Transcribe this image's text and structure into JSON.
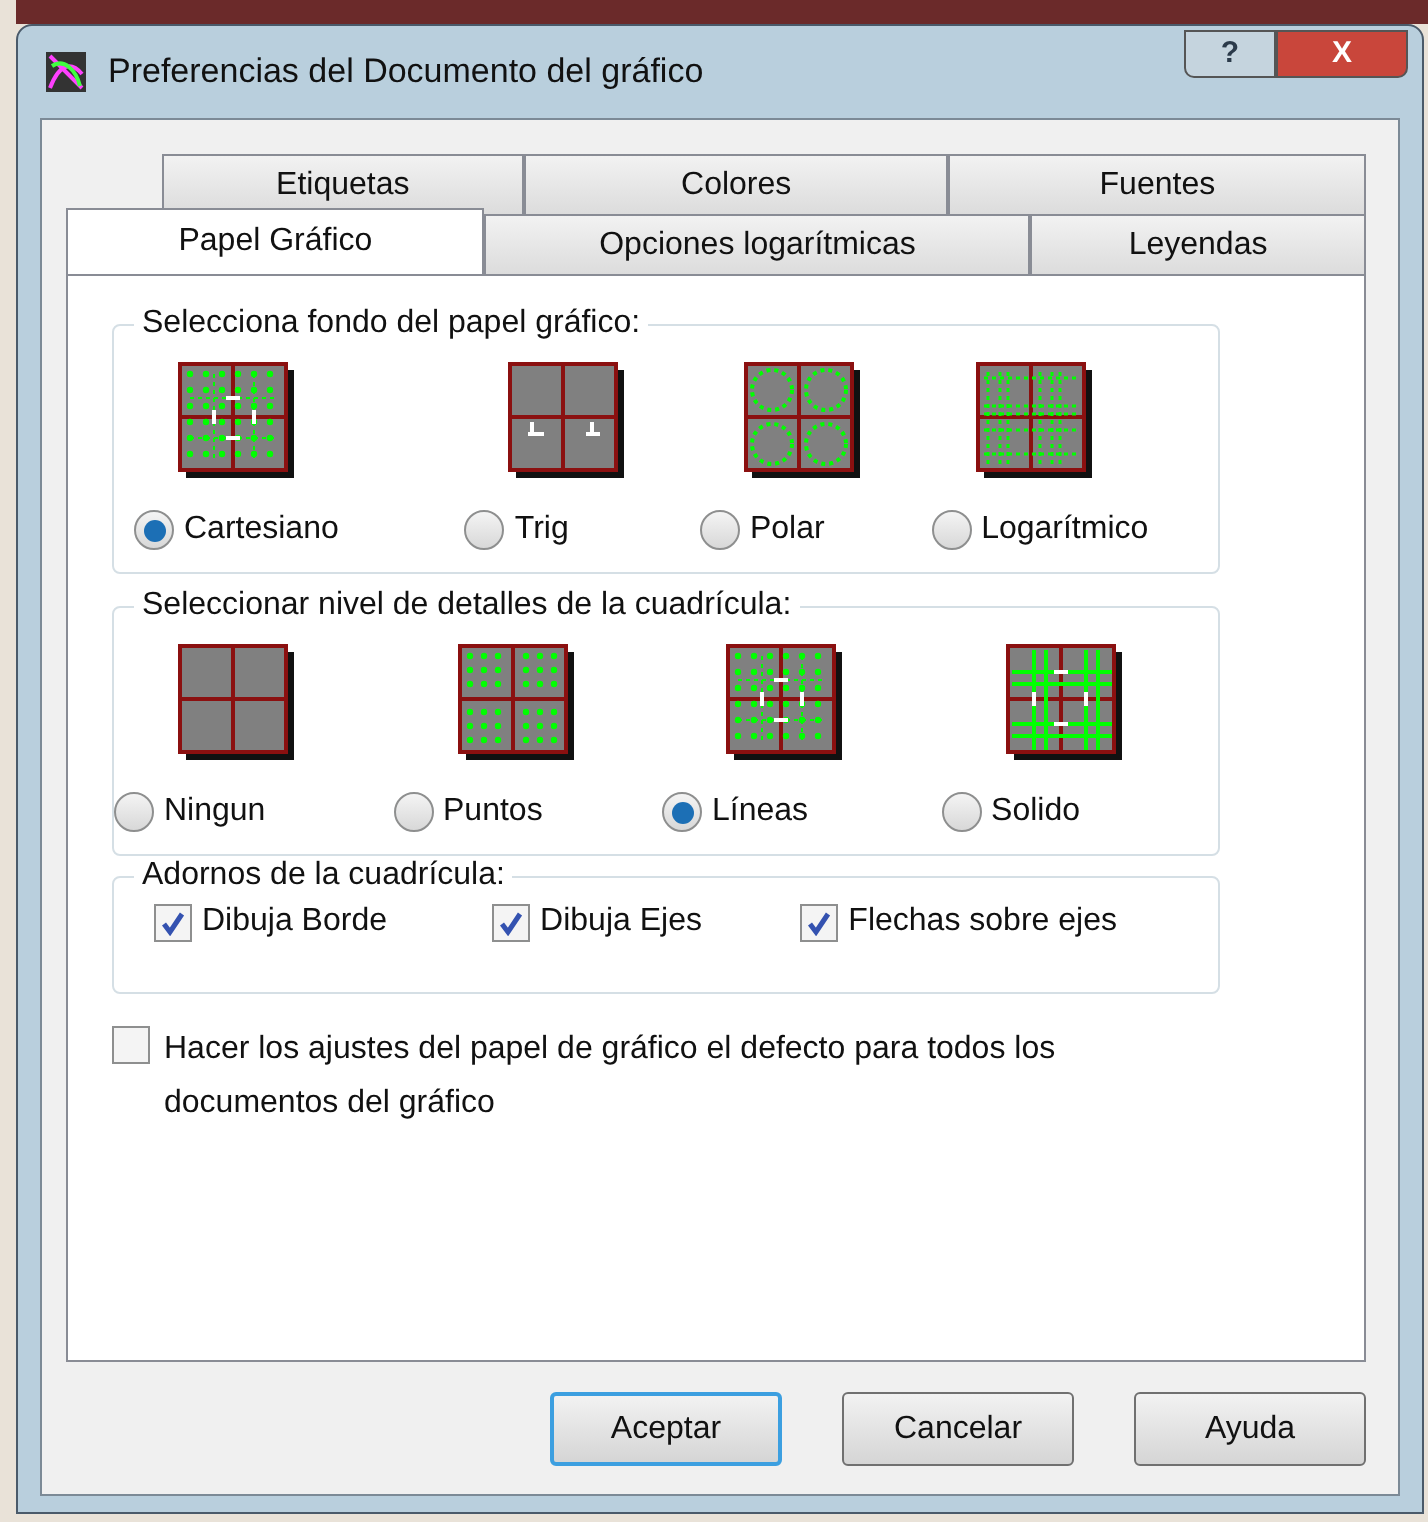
{
  "window": {
    "title": "Preferencias del Documento del gráfico",
    "buttons": [
      "?",
      "X"
    ]
  },
  "tab_rows": [
    [
      {
        "label": "Etiquetas",
        "selected": false
      },
      {
        "label": "Colores",
        "selected": false
      },
      {
        "label": "Fuentes",
        "selected": false
      }
    ],
    [
      {
        "label": "Papel Gráfico",
        "selected": true
      },
      {
        "label": "Opciones logarítmicas",
        "selected": false
      },
      {
        "label": "Leyendas",
        "selected": false
      }
    ]
  ],
  "background_group": {
    "title": "Selecciona fondo del papel gráfico:",
    "options": [
      {
        "label": "Cartesiano",
        "selected": true
      },
      {
        "label": "Trig",
        "selected": false
      },
      {
        "label": "Polar",
        "selected": false
      },
      {
        "label": "Logarítmico",
        "selected": false
      }
    ]
  },
  "detail_group": {
    "title": "Seleccionar nivel de detalles de la cuadrícula:",
    "options": [
      {
        "label": "Ningun",
        "selected": false
      },
      {
        "label": "Puntos",
        "selected": false
      },
      {
        "label": "Líneas",
        "selected": true
      },
      {
        "label": "Solido",
        "selected": false
      }
    ]
  },
  "decorations_group": {
    "title": "Adornos de la cuadrícula:",
    "options": [
      {
        "label": "Dibuja Borde",
        "checked": true
      },
      {
        "label": "Dibuja Ejes",
        "checked": true
      },
      {
        "label": "Flechas sobre ejes",
        "checked": true
      }
    ]
  },
  "default_option": {
    "label": "Hacer los ajustes del papel de gráfico el defecto para todos los documentos del gráfico",
    "checked": false
  },
  "buttons": [
    {
      "label": "Aceptar",
      "selected": true
    },
    {
      "label": "Cancelar",
      "selected": false
    },
    {
      "label": "Ayuda",
      "selected": false
    }
  ]
}
